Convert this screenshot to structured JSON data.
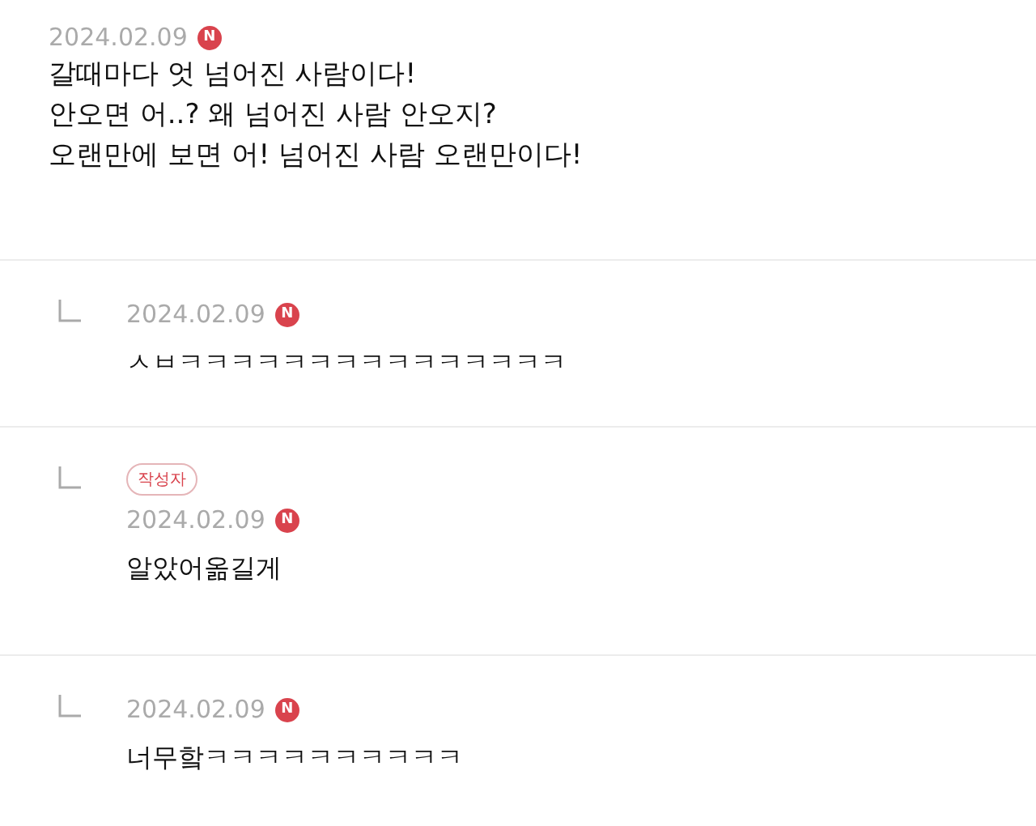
{
  "comments": [
    {
      "kind": "comment",
      "date": "2024.02.09",
      "new_badge": "N",
      "lines": [
        "갈때마다 엇 넘어진 사람이다!",
        "안오면 어..? 왜 넘어진 사람 안오지?",
        "오랜만에 보면 어! 넘어진 사람 오랜만이다!"
      ]
    },
    {
      "kind": "reply",
      "date": "2024.02.09",
      "new_badge": "N",
      "lines": [
        "ㅅㅂㅋㅋㅋㅋㅋㅋㅋㅋㅋㅋㅋㅋㅋㅋㅋ"
      ]
    },
    {
      "kind": "reply",
      "author_badge": "작성자",
      "date": "2024.02.09",
      "new_badge": "N",
      "lines": [
        "알았어옮길게"
      ]
    },
    {
      "kind": "reply",
      "date": "2024.02.09",
      "new_badge": "N",
      "lines": [
        "너무핰ㅋㅋㅋㅋㅋㅋㅋㅋㅋㅋ"
      ]
    }
  ]
}
